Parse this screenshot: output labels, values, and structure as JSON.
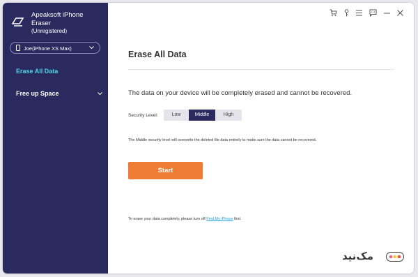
{
  "app": {
    "title": "Apeaksoft iPhone Eraser",
    "registration": "(Unregistered)"
  },
  "device": {
    "name": "Joe(iPhone XS Max)"
  },
  "sidebar": {
    "items": [
      {
        "label": "Erase All Data",
        "active": true
      },
      {
        "label": "Free up Space",
        "active": false
      }
    ]
  },
  "toolbar": {
    "icons": [
      "cart-icon",
      "key-icon",
      "menu-icon",
      "feedback-icon",
      "minimize-icon",
      "close-icon"
    ]
  },
  "main": {
    "heading": "Erase All Data",
    "warning": "The data on your device will be completely erased and cannot be recovered.",
    "security_label": "Security Level:",
    "levels": [
      "Low",
      "Middle",
      "High"
    ],
    "selected_level": "Middle",
    "level_note": "The Middle security level will overwrite the deleted file data entirely to make sure the data cannot be recovered.",
    "start_label": "Start",
    "footer_prefix": "To erase your data completely, please turn off",
    "footer_link": "Find My iPhone",
    "footer_suffix": "first."
  },
  "watermark": {
    "text": "مک‌نید"
  },
  "colors": {
    "sidebar_bg": "#2b2a5e",
    "active_nav": "#4fd6e4",
    "start_button": "#f07b35",
    "link": "#1ea0d8"
  }
}
